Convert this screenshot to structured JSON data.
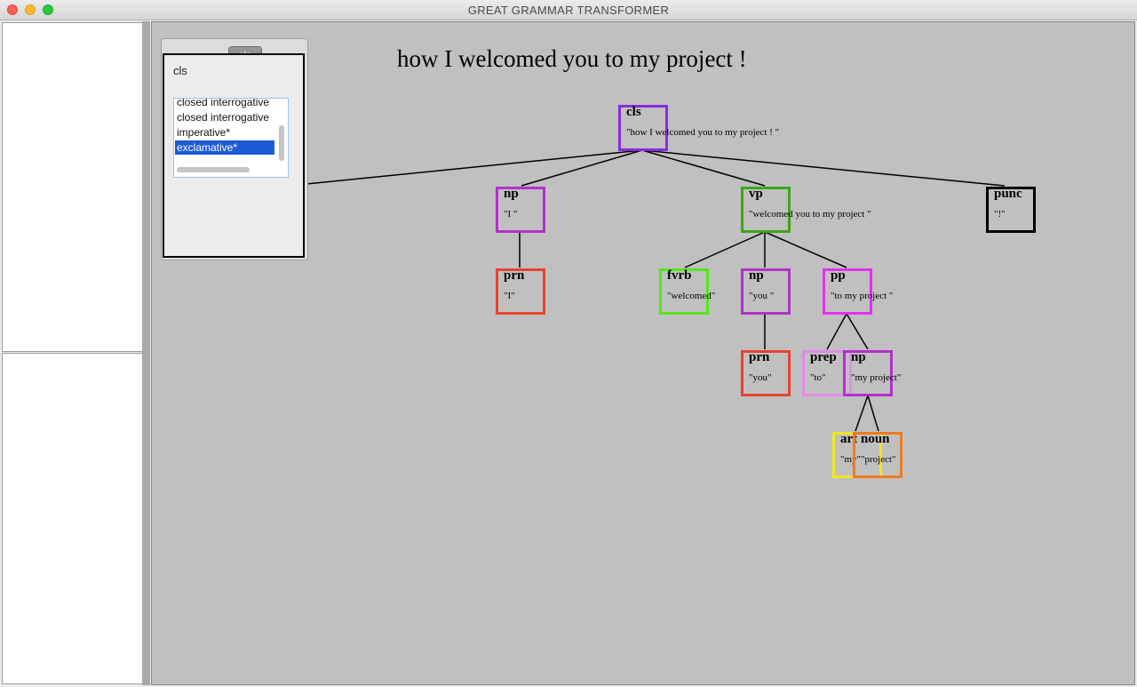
{
  "window": {
    "title": "GREAT GRAMMAR TRANSFORMER"
  },
  "panel": {
    "tab_label": "cls",
    "heading": "cls",
    "list_items": [
      "closed interrogative",
      "closed interrogative",
      "imperative*",
      "exclamative*"
    ],
    "selected_index": 3
  },
  "sentence": "how I welcomed you to my project !",
  "tree": {
    "cls": {
      "cat": "cls",
      "text": "\"how I welcomed you to my project ! \"",
      "color": "#8a2be2"
    },
    "np1": {
      "cat": "np",
      "text": "\"I \"",
      "color": "#b131c8"
    },
    "prn1": {
      "cat": "prn",
      "text": "\"I\"",
      "color": "#e8432f"
    },
    "vp": {
      "cat": "vp",
      "text": "\"welcomed you to my project \"",
      "color": "#3aa818"
    },
    "fvrb": {
      "cat": "fvrb",
      "text": "\"welcomed\"",
      "color": "#55e81c"
    },
    "np2": {
      "cat": "np",
      "text": "\"you \"",
      "color": "#b131c8"
    },
    "prn2": {
      "cat": "prn",
      "text": "\"you\"",
      "color": "#e8432f"
    },
    "pp": {
      "cat": "pp",
      "text": "\"to my project \"",
      "color": "#e72ef0"
    },
    "prep": {
      "cat": "prep",
      "text": "\"to\"",
      "color": "#e08ce8"
    },
    "np3": {
      "cat": "np",
      "text": "\"my project\"",
      "color": "#b131c8"
    },
    "art": {
      "cat": "art",
      "text": "\"my\"",
      "color": "#f2e51c"
    },
    "noun": {
      "cat": "noun",
      "text": "\"project\"",
      "color": "#f07b1c"
    },
    "punc": {
      "cat": "punc",
      "text": "\"!\"",
      "color": "#000000"
    }
  }
}
